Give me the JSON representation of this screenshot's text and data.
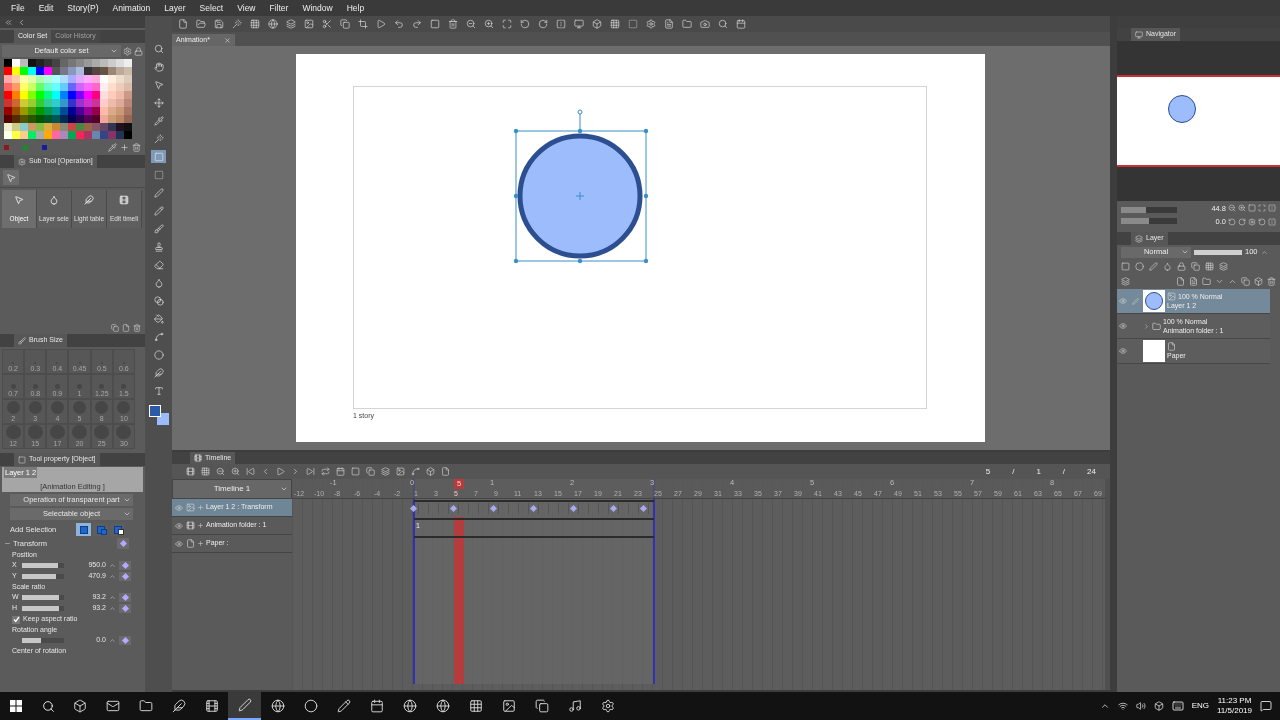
{
  "menu": [
    "File",
    "Edit",
    "Story(P)",
    "Animation",
    "Layer",
    "Select",
    "View",
    "Filter",
    "Window",
    "Help"
  ],
  "color_set": {
    "tabs": [
      {
        "label": "Color Set",
        "selected": true
      },
      {
        "label": "Color History",
        "selected": false
      }
    ],
    "set_name": "Default color set",
    "rows": [
      [
        {
          "color": "#000000"
        },
        {
          "color": "#ffffff"
        },
        {
          "color": "#bbbbbb"
        },
        {
          "color": "#111111"
        },
        {
          "color": "#222222"
        },
        {
          "color": "#333333"
        },
        {
          "color": "#444444"
        },
        {
          "color": "#666666"
        },
        {
          "color": "#777777"
        },
        {
          "color": "#888888"
        },
        {
          "color": "#999999"
        },
        {
          "color": "#aaaaaa"
        },
        {
          "color": "#bbbbbb"
        },
        {
          "color": "#cccccc"
        },
        {
          "color": "#dddddd"
        },
        {
          "color": "#eeeeee"
        }
      ],
      [
        {
          "color": "#ff0000"
        },
        {
          "color": "#ffff00"
        },
        {
          "color": "#00ff00"
        },
        {
          "color": "#00ffff"
        },
        {
          "color": "#0000ff"
        },
        {
          "color": "#ff00ff"
        },
        {
          "color": "#555555"
        },
        {
          "color": "#777788"
        },
        {
          "color": "#8899bb"
        },
        {
          "color": "#aabbdd"
        },
        {
          "color": "#333333"
        },
        {
          "color": "#554444"
        },
        {
          "color": "#665544"
        },
        {
          "color": "#998877"
        },
        {
          "color": "#bbaa99"
        },
        {
          "color": "#ccbbaa"
        }
      ],
      [
        {
          "color": "#ffaaaa"
        },
        {
          "color": "#ffccaa"
        },
        {
          "color": "#ffffaa"
        },
        {
          "color": "#ddffaa"
        },
        {
          "color": "#aaffaa"
        },
        {
          "color": "#aaffdd"
        },
        {
          "color": "#aaffff"
        },
        {
          "color": "#aaddff"
        },
        {
          "color": "#aaaaff"
        },
        {
          "color": "#ddaaff"
        },
        {
          "color": "#ffaaff"
        },
        {
          "color": "#ffaadd"
        },
        {
          "color": "#ffffff"
        },
        {
          "color": "#ffeedd"
        },
        {
          "color": "#eeddcc"
        },
        {
          "color": "#ddccbb"
        }
      ],
      [
        {
          "color": "#ff6666"
        },
        {
          "color": "#ff9966"
        },
        {
          "color": "#ffff66"
        },
        {
          "color": "#ccff66"
        },
        {
          "color": "#66ff66"
        },
        {
          "color": "#66ffcc"
        },
        {
          "color": "#66ffff"
        },
        {
          "color": "#66ccff"
        },
        {
          "color": "#6666ff"
        },
        {
          "color": "#cc66ff"
        },
        {
          "color": "#ff66ff"
        },
        {
          "color": "#ff66cc"
        },
        {
          "color": "#ffeeee"
        },
        {
          "color": "#ffddcc"
        },
        {
          "color": "#eeccbb"
        },
        {
          "color": "#ddbbaa"
        }
      ],
      [
        {
          "color": "#ff0000"
        },
        {
          "color": "#ff8000"
        },
        {
          "color": "#ffff00"
        },
        {
          "color": "#80ff00"
        },
        {
          "color": "#00ff00"
        },
        {
          "color": "#00ff80"
        },
        {
          "color": "#00ffff"
        },
        {
          "color": "#0080ff"
        },
        {
          "color": "#0000ff"
        },
        {
          "color": "#8000ff"
        },
        {
          "color": "#ff00ff"
        },
        {
          "color": "#ff0080"
        },
        {
          "color": "#ffdddd"
        },
        {
          "color": "#ffccbb"
        },
        {
          "color": "#eebbaa"
        },
        {
          "color": "#cc9988"
        }
      ],
      [
        {
          "color": "#cc3333"
        },
        {
          "color": "#cc6633"
        },
        {
          "color": "#cccc33"
        },
        {
          "color": "#99cc33"
        },
        {
          "color": "#33cc33"
        },
        {
          "color": "#33cc99"
        },
        {
          "color": "#33cccc"
        },
        {
          "color": "#3399cc"
        },
        {
          "color": "#3333cc"
        },
        {
          "color": "#9933cc"
        },
        {
          "color": "#cc33cc"
        },
        {
          "color": "#cc3399"
        },
        {
          "color": "#ffcccc"
        },
        {
          "color": "#eebbaa"
        },
        {
          "color": "#ddaa99"
        },
        {
          "color": "#bb8877"
        }
      ],
      [
        {
          "color": "#990000"
        },
        {
          "color": "#994c00"
        },
        {
          "color": "#999900"
        },
        {
          "color": "#4c9900"
        },
        {
          "color": "#009900"
        },
        {
          "color": "#00994c"
        },
        {
          "color": "#009999"
        },
        {
          "color": "#004c99"
        },
        {
          "color": "#000099"
        },
        {
          "color": "#4c0099"
        },
        {
          "color": "#990099"
        },
        {
          "color": "#99004c"
        },
        {
          "color": "#ffbbaa"
        },
        {
          "color": "#ddaa88"
        },
        {
          "color": "#cc9977"
        },
        {
          "color": "#aa7766"
        }
      ],
      [
        {
          "color": "#550000"
        },
        {
          "color": "#552a00"
        },
        {
          "color": "#555500"
        },
        {
          "color": "#2a5500"
        },
        {
          "color": "#005500"
        },
        {
          "color": "#00552a"
        },
        {
          "color": "#005555"
        },
        {
          "color": "#002a55"
        },
        {
          "color": "#000055"
        },
        {
          "color": "#2a0055"
        },
        {
          "color": "#550055"
        },
        {
          "color": "#55002a"
        },
        {
          "color": "#eeaa99"
        },
        {
          "color": "#cc9977"
        },
        {
          "color": "#bb8866"
        },
        {
          "color": "#996655"
        }
      ],
      [
        {
          "color": "#eeeecc"
        },
        {
          "color": "#cccc88"
        },
        {
          "color": "#88cccc"
        },
        {
          "color": "#cc9966"
        },
        {
          "color": "#88bb44"
        },
        {
          "color": "#ddaa44"
        },
        {
          "color": "#cc8833"
        },
        {
          "color": "#888877"
        },
        {
          "color": "#cc4444"
        },
        {
          "color": "#448844"
        },
        {
          "color": "#996644"
        },
        {
          "color": "#885566"
        },
        {
          "color": "#664466"
        },
        {
          "color": "#333355"
        },
        {
          "color": "#221122"
        },
        {
          "color": "#111111"
        }
      ],
      [
        {
          "color": "#ffffee"
        },
        {
          "color": "#ffff44"
        },
        {
          "color": "#ffcc88"
        },
        {
          "color": "#00ee66"
        },
        {
          "color": "#aaaaaa"
        },
        {
          "color": "#ffaa00"
        },
        {
          "color": "#ff66aa"
        },
        {
          "color": "#aa88bb"
        },
        {
          "color": "#00aa55"
        },
        {
          "color": "#ff2255"
        },
        {
          "color": "#aa3366"
        },
        {
          "color": "#6688aa"
        },
        {
          "color": "#334488"
        },
        {
          "color": "#883366"
        },
        {
          "color": "#223355"
        },
        {
          "color": "#000000"
        }
      ]
    ],
    "recent": [
      {
        "color": "#8b1a1a"
      },
      {
        "color": "#1a8b2a"
      },
      {
        "color": "#1a1a9b"
      }
    ]
  },
  "sub_tool": {
    "title": "Sub Tool [Operation]",
    "items": [
      {
        "label": "Object",
        "selected": true
      },
      {
        "label": "Layer sele",
        "selected": false
      },
      {
        "label": "Light table",
        "selected": false
      },
      {
        "label": "Edit timeli",
        "selected": false
      }
    ]
  },
  "brush_size": {
    "title": "Brush Size",
    "sizes": [
      "0.2",
      "0.3",
      "0.4",
      "0.45",
      "0.5",
      "0.6",
      "0.7",
      "0.8",
      "0.9",
      "1",
      "1.25",
      "1.5",
      "2",
      "3",
      "4",
      "5",
      "8",
      "10",
      "12",
      "15",
      "17",
      "20",
      "25",
      "30"
    ]
  },
  "tool_property": {
    "title": "Tool property [Object]",
    "preview_layer": "Layer 1 2",
    "preview_mode": "[Animation Editing ]",
    "dropdowns": [
      "Operation of transparent part",
      "Selectable object"
    ],
    "add_selection": "Add Selection",
    "add_modes": [
      {
        "kind": "new",
        "selected": true
      },
      {
        "kind": "add",
        "selected": false
      },
      {
        "kind": "subtract",
        "selected": false
      }
    ],
    "transform": "Transform",
    "groups": [
      {
        "label": "Position",
        "fields": [
          {
            "axis": "X",
            "value": "950.0",
            "level": 0.85
          },
          {
            "axis": "Y",
            "value": "470.9",
            "level": 0.8
          }
        ]
      },
      {
        "label": "Scale ratio",
        "fields": [
          {
            "axis": "W",
            "value": "93.2",
            "level": 0.88
          },
          {
            "axis": "H",
            "value": "93.2",
            "level": 0.88
          }
        ]
      }
    ],
    "keep_aspect": {
      "label": "Keep aspect ratio",
      "checked": true
    },
    "rotation": {
      "label": "Rotation angle",
      "value": "0.0",
      "level": 0.45
    },
    "center_label": "Center of rotation"
  },
  "tools": [
    {
      "selected": false
    },
    {
      "selected": false
    },
    {
      "selected": false
    },
    {
      "selected": false
    },
    {
      "selected": false
    },
    {
      "selected": false
    },
    {
      "selected": true
    },
    {
      "selected": false
    },
    {
      "selected": false
    },
    {
      "selected": false
    },
    {
      "selected": false
    },
    {
      "selected": false
    },
    {
      "selected": false
    },
    {
      "selected": false
    },
    {
      "selected": false
    },
    {
      "selected": false
    },
    {
      "selected": false
    },
    {
      "selected": false
    },
    {
      "selected": false
    },
    {
      "selected": false
    }
  ],
  "colors": [
    {
      "color": "#2a5aa8"
    },
    {
      "color": "#9bbcfa"
    }
  ],
  "document_tab": "Animation*",
  "canvas": {
    "caption": "1 story"
  },
  "timeline": {
    "title": "Timeline",
    "counter": [
      "5",
      "/",
      "1",
      "/",
      "24"
    ],
    "name": "Timeline 1",
    "seconds": [
      "-1",
      "0",
      "1",
      "2",
      "3",
      "4",
      "5",
      "6",
      "7",
      "8"
    ],
    "current_frame": "5",
    "frames": [
      {
        "text": "-12",
        "selected": false
      },
      {
        "text": "-10",
        "selected": false
      },
      {
        "text": "-8",
        "selected": false
      },
      {
        "text": "-6",
        "selected": false
      },
      {
        "text": "-4",
        "selected": false
      },
      {
        "text": "-2",
        "selected": false
      },
      {
        "text": "1",
        "selected": false
      },
      {
        "text": "3",
        "selected": false
      },
      {
        "text": "5",
        "selected": true
      },
      {
        "text": "7",
        "selected": false
      },
      {
        "text": "9",
        "selected": false
      },
      {
        "text": "11",
        "selected": false
      },
      {
        "text": "13",
        "selected": false
      },
      {
        "text": "15",
        "selected": false
      },
      {
        "text": "17",
        "selected": false
      },
      {
        "text": "19",
        "selected": false
      },
      {
        "text": "21",
        "selected": false
      },
      {
        "text": "23",
        "selected": false
      },
      {
        "text": "25",
        "selected": false
      },
      {
        "text": "27",
        "selected": false
      },
      {
        "text": "29",
        "selected": false
      },
      {
        "text": "31",
        "selected": false
      },
      {
        "text": "33",
        "selected": false
      },
      {
        "text": "35",
        "selected": false
      },
      {
        "text": "37",
        "selected": false
      },
      {
        "text": "39",
        "selected": false
      },
      {
        "text": "41",
        "selected": false
      },
      {
        "text": "43",
        "selected": false
      },
      {
        "text": "45",
        "selected": false
      },
      {
        "text": "47",
        "selected": false
      },
      {
        "text": "49",
        "selected": false
      },
      {
        "text": "51",
        "selected": false
      },
      {
        "text": "53",
        "selected": false
      },
      {
        "text": "55",
        "selected": false
      },
      {
        "text": "57",
        "selected": false
      },
      {
        "text": "59",
        "selected": false
      },
      {
        "text": "61",
        "selected": false
      },
      {
        "text": "63",
        "selected": false
      },
      {
        "text": "65",
        "selected": false
      },
      {
        "text": "67",
        "selected": false
      },
      {
        "text": "69",
        "selected": false
      }
    ],
    "tracks": [
      {
        "kind": "layer",
        "name": "Layer 1 2 : Transform",
        "selected": true,
        "visible": true,
        "keyframes": [
          true,
          false,
          false,
          false,
          true,
          false,
          false,
          false,
          true,
          false,
          false,
          false,
          true,
          false,
          false,
          false,
          true,
          false,
          false,
          false,
          true,
          false,
          false,
          true
        ]
      },
      {
        "kind": "folder",
        "name": "Animation folder : 1",
        "selected": false,
        "visible": true,
        "cels": [
          "1"
        ]
      },
      {
        "kind": "paper",
        "name": "Paper :",
        "selected": false,
        "visible": true
      }
    ]
  },
  "navigator": {
    "title": "Navigator",
    "zoom": "44.8",
    "angle": "0.0",
    "zoom_slider": {
      "level": 0.45
    },
    "rotation_slider": {
      "level": 0.5
    }
  },
  "layers": {
    "title": "Layer",
    "blend": "Normal",
    "opacity": "100",
    "opacity_slider": {
      "level": 1
    },
    "items": [
      {
        "kind": "layer",
        "mode": "100 % Normal",
        "name": "Layer 1 2",
        "selected": true,
        "visible": true
      },
      {
        "kind": "folder",
        "mode": "100 % Normal",
        "name": "Animation folder : 1",
        "selected": false,
        "visible": true
      },
      {
        "kind": "paper",
        "name": "Paper",
        "selected": false,
        "visible": true
      }
    ]
  },
  "taskbar": {
    "apps": [
      {
        "selected": false
      },
      {
        "selected": false
      },
      {
        "selected": false
      },
      {
        "selected": false
      },
      {
        "selected": false
      },
      {
        "selected": true
      },
      {
        "selected": false
      },
      {
        "selected": false
      },
      {
        "selected": false
      },
      {
        "selected": false
      },
      {
        "selected": false
      },
      {
        "selected": false
      },
      {
        "selected": false
      },
      {
        "selected": false
      },
      {
        "selected": false
      },
      {
        "selected": false
      },
      {
        "selected": false
      }
    ],
    "language": "ENG",
    "time": "11:23 PM",
    "date": "11/5/2019"
  }
}
